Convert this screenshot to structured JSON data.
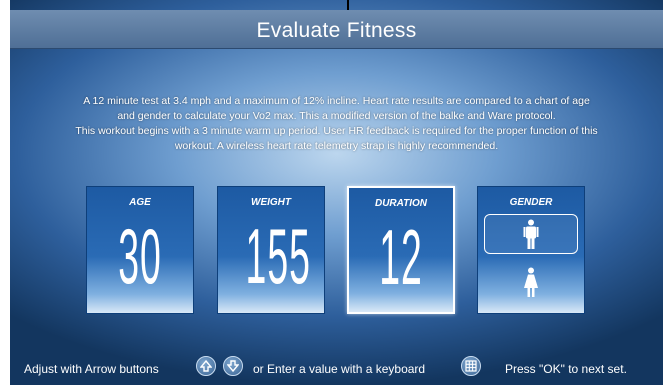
{
  "header": {
    "title": "Evaluate Fitness"
  },
  "description": [
    "A 12 minute test at 3.4 mph and a maximum of 12% incline. Heart rate results are compared to a chart of  age",
    "and gender to calculate your Vo2 max. This a modified version of the balke and Ware protocol.",
    "This workout begins with a 3 minute warm up period. User HR feedback is required for the proper function of this",
    "workout. A wireless heart rate  telemetry strap is highly recommended."
  ],
  "cards": {
    "age": {
      "label": "AGE",
      "value": "30"
    },
    "weight": {
      "label": "WEIGHT",
      "value": "155"
    },
    "duration": {
      "label": "DURATION",
      "value": "12"
    },
    "gender": {
      "label": "GENDER",
      "selected": "male"
    }
  },
  "footer": {
    "adjust_text": "Adjust with Arrow buttons",
    "or_text": "or  Enter a value with a keyboard",
    "ok_text": "Press \"OK\" to next set."
  },
  "icons": {
    "up": "home-up-arrow-icon",
    "down": "down-arrow-icon",
    "keyboard": "keyboard-icon",
    "male": "male-icon",
    "female": "female-icon"
  }
}
